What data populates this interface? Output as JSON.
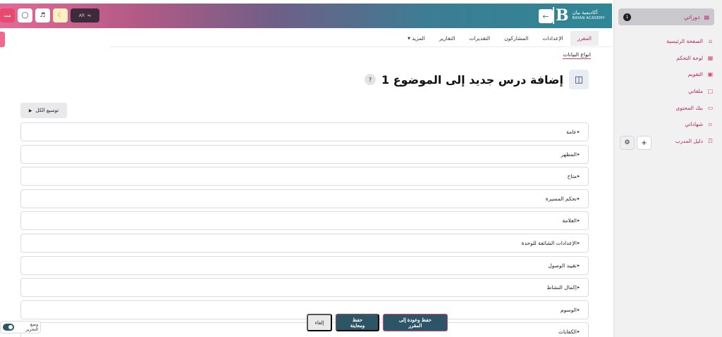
{
  "sidebar": {
    "courses": {
      "label": "دوراتي",
      "badge": "1"
    },
    "items": [
      {
        "label": "الصفحة الرئيسية",
        "icon": "home-icon"
      },
      {
        "label": "لوحة التحكم",
        "icon": "dashboard-icon"
      },
      {
        "label": "التقويم",
        "icon": "calendar-icon"
      },
      {
        "label": "ملفاتي",
        "icon": "files-icon"
      },
      {
        "label": "بنك المحتوى",
        "icon": "folder-icon"
      },
      {
        "label": "شهاداتي",
        "icon": "certificate-icon"
      },
      {
        "label": "دليل المدرب",
        "icon": "guide-icon"
      }
    ],
    "tools": {
      "add_icon": "plus-icon",
      "settings_icon": "gear-icon"
    }
  },
  "topbar": {
    "brand_ar": "أكاديمية بيان",
    "brand_en": "BAYAN ACADEMY",
    "logo_letter": "B",
    "lang": "AR",
    "user_initials": "مت"
  },
  "tabs": [
    {
      "label": "المقرر",
      "active": true
    },
    {
      "label": "الإعدادات",
      "active": false
    },
    {
      "label": "المشاركون",
      "active": false
    },
    {
      "label": "التقديرات",
      "active": false
    },
    {
      "label": "التقارير",
      "active": false
    },
    {
      "label": "المزيد",
      "active": false
    }
  ],
  "breadcrumb": "انواع البيانات",
  "page": {
    "title": "إضافة درس جديد إلى الموضوع 1"
  },
  "expand_all": "توسيع الكل",
  "sections": [
    "عامة",
    "المظهر",
    "متاح",
    "تحكم المسيرة",
    "العلامة",
    "الإعدادات الشائعة للوحدة",
    "تقييد الوصول",
    "إكمال النشاط",
    "الوسوم",
    "الكفايات"
  ],
  "footer": {
    "save_return": "حفظ وعودة إلى المقرر",
    "save_view": "حفظ ومعاينة",
    "cancel": "إلغاء"
  },
  "edit_mode": {
    "label": "وضع التحرير",
    "on": true
  },
  "colors": {
    "accent": "#b5245c",
    "primary": "#2c5667",
    "teal": "#2f8795",
    "pink": "#e26a96"
  }
}
